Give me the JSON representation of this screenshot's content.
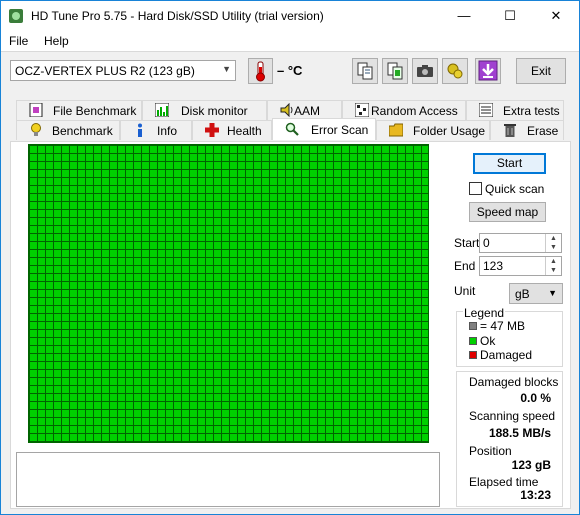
{
  "window": {
    "title": "HD Tune Pro 5.75 - Hard Disk/SSD Utility (trial version)",
    "minimize": "—",
    "maximize": "☐",
    "close": "✕"
  },
  "menu": {
    "file": "File",
    "help": "Help"
  },
  "toolbar": {
    "drive": "OCZ-VERTEX PLUS R2 (123 gB)",
    "temperature": "– °C",
    "exit_label": "Exit"
  },
  "tabs": {
    "row1": [
      "File Benchmark",
      "Disk monitor",
      "AAM",
      "Random Access",
      "Extra tests"
    ],
    "row2": [
      "Benchmark",
      "Info",
      "Health",
      "Error Scan",
      "Folder Usage",
      "Erase"
    ],
    "active": "Error Scan"
  },
  "scan": {
    "start_button": "Start",
    "quick_scan_label": "Quick scan",
    "quick_scan_checked": false,
    "speed_map_button": "Speed map",
    "start_label": "Start",
    "start_value": "0",
    "end_label": "End",
    "end_value": "123",
    "unit_label": "Unit",
    "unit_value": "gB"
  },
  "legend": {
    "title": "Legend",
    "items": [
      {
        "label": "= 47 MB",
        "color": "#808080"
      },
      {
        "label": "Ok",
        "color": "#00d000"
      },
      {
        "label": "Damaged",
        "color": "#e00000"
      }
    ]
  },
  "stats": {
    "damaged_blocks_label": "Damaged blocks",
    "damaged_blocks_value": "0.0 %",
    "scanning_speed_label": "Scanning speed",
    "scanning_speed_value": "188.5 MB/s",
    "position_label": "Position",
    "position_value": "123 gB",
    "elapsed_label": "Elapsed time",
    "elapsed_value": "13:23"
  },
  "colors": {
    "ok": "#00d000",
    "grid_line": "#006400",
    "accent": "#0078d7"
  }
}
